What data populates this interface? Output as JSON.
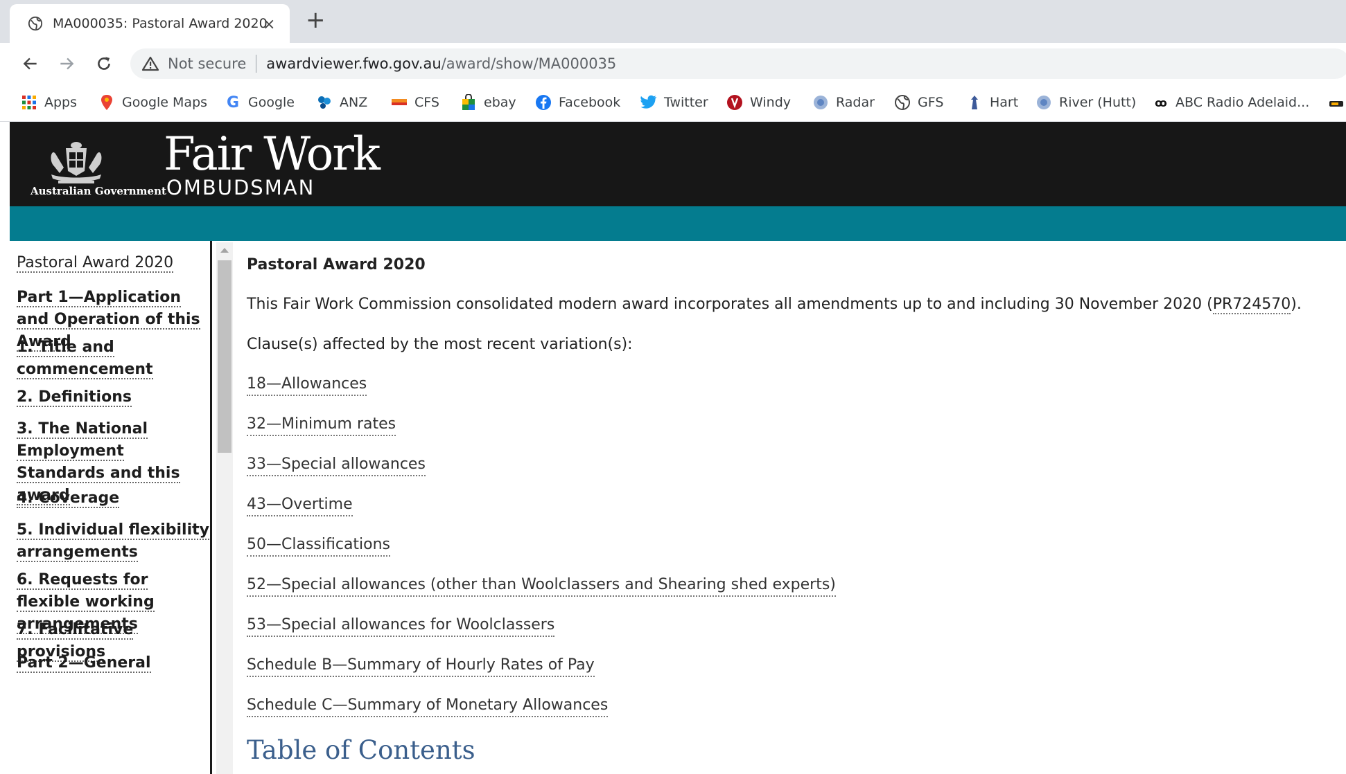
{
  "browser": {
    "tab_title": "MA000035: Pastoral Award 2020",
    "tab_close": "×",
    "new_tab": "+",
    "security_label": "Not secure",
    "url_host": "awardviewer.fwo.gov.au",
    "url_path": "/award/show/MA000035"
  },
  "bookmarks": [
    {
      "label": "Apps",
      "icon": "apps-grid-icon"
    },
    {
      "label": "Google Maps",
      "icon": "map-pin-icon"
    },
    {
      "label": "Google",
      "icon": "google-icon"
    },
    {
      "label": "ANZ",
      "icon": "anz-icon"
    },
    {
      "label": "CFS",
      "icon": "cfs-icon"
    },
    {
      "label": "ebay",
      "icon": "shopping-bag-icon"
    },
    {
      "label": "Facebook",
      "icon": "facebook-icon"
    },
    {
      "label": "Twitter",
      "icon": "twitter-icon"
    },
    {
      "label": "Windy",
      "icon": "windy-icon"
    },
    {
      "label": "Radar",
      "icon": "radar-icon"
    },
    {
      "label": "GFS",
      "icon": "globe-icon"
    },
    {
      "label": "Hart",
      "icon": "hart-icon"
    },
    {
      "label": "River (Hutt)",
      "icon": "river-icon"
    },
    {
      "label": "ABC Radio Adelaid...",
      "icon": "abc-icon"
    }
  ],
  "header": {
    "gov_label": "Australian Government",
    "brand_title": "Fair Work",
    "brand_sub": "OMBUDSMAN",
    "colors": {
      "header_bg": "#171717",
      "band": "#047c8f"
    }
  },
  "sidebar": {
    "items": [
      {
        "label": "Pastoral Award 2020",
        "bold": false
      },
      {
        "label": "Part 1—Application and Operation of this Award",
        "bold": true
      },
      {
        "label": "1. Title and commencement",
        "bold": true
      },
      {
        "label": "2. Definitions",
        "bold": true
      },
      {
        "label": "3. The National Employment Standards and this award",
        "bold": true
      },
      {
        "label": "4. Coverage",
        "bold": true
      },
      {
        "label": "5. Individual flexibility arrangements",
        "bold": true
      },
      {
        "label": "6. Requests for flexible working arrangements",
        "bold": true
      },
      {
        "label": "7. Facilitative provisions",
        "bold": true
      },
      {
        "label": "Part 2—General",
        "bold": true
      }
    ]
  },
  "main": {
    "heading": "Pastoral Award 2020",
    "intro_before": "This Fair Work Commission consolidated modern award incorporates all amendments up to and including 30 November 2020 (",
    "intro_link": "PR724570",
    "intro_after": ").",
    "affected_label": "Clause(s) affected by the most recent variation(s):",
    "clauses": [
      "18—Allowances",
      "32—Minimum rates",
      "33—Special allowances",
      "43—Overtime",
      "50—Classifications",
      "52—Special allowances (other than Woolclassers and Shearing shed experts)",
      "53—Special allowances for Woolclassers",
      "Schedule B—Summary of Hourly Rates of Pay",
      "Schedule C—Summary of Monetary Allowances"
    ],
    "toc_heading": "Table of Contents"
  }
}
